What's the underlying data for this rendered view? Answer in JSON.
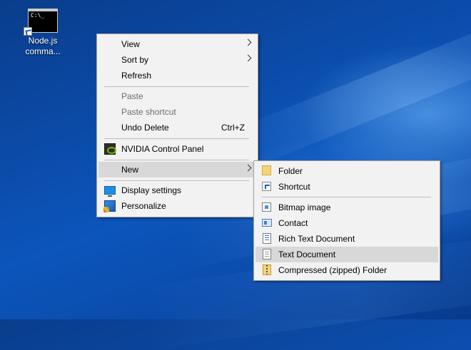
{
  "desktop": {
    "icon": {
      "name": "Node.js comma...",
      "line1": "Node.js",
      "line2": "comma...",
      "glyph_text": "C:\\_"
    }
  },
  "context_menu": {
    "items": [
      {
        "label": "View",
        "has_submenu": true
      },
      {
        "label": "Sort by",
        "has_submenu": true
      },
      {
        "label": "Refresh"
      },
      {
        "label": "Paste",
        "disabled": true
      },
      {
        "label": "Paste shortcut",
        "disabled": true
      },
      {
        "label": "Undo Delete",
        "shortcut": "Ctrl+Z"
      },
      {
        "label": "NVIDIA Control Panel",
        "icon": "nvidia-icon"
      },
      {
        "label": "New",
        "has_submenu": true,
        "highlighted": true
      },
      {
        "label": "Display settings",
        "icon": "display-settings-icon"
      },
      {
        "label": "Personalize",
        "icon": "personalize-icon"
      }
    ]
  },
  "new_submenu": {
    "items": [
      {
        "label": "Folder",
        "icon": "folder-icon"
      },
      {
        "label": "Shortcut",
        "icon": "shortcut-icon"
      },
      {
        "label": "Bitmap image",
        "icon": "bitmap-icon"
      },
      {
        "label": "Contact",
        "icon": "contact-icon"
      },
      {
        "label": "Rich Text Document",
        "icon": "rich-text-icon"
      },
      {
        "label": "Text Document",
        "icon": "text-document-icon",
        "highlighted": true
      },
      {
        "label": "Compressed (zipped) Folder",
        "icon": "zip-folder-icon"
      }
    ]
  },
  "colors": {
    "desktop_bg": "#0b4aa6",
    "menu_bg": "#f2f2f2",
    "menu_highlight": "#d8d8d8",
    "disabled_text": "#6d6d6d"
  }
}
